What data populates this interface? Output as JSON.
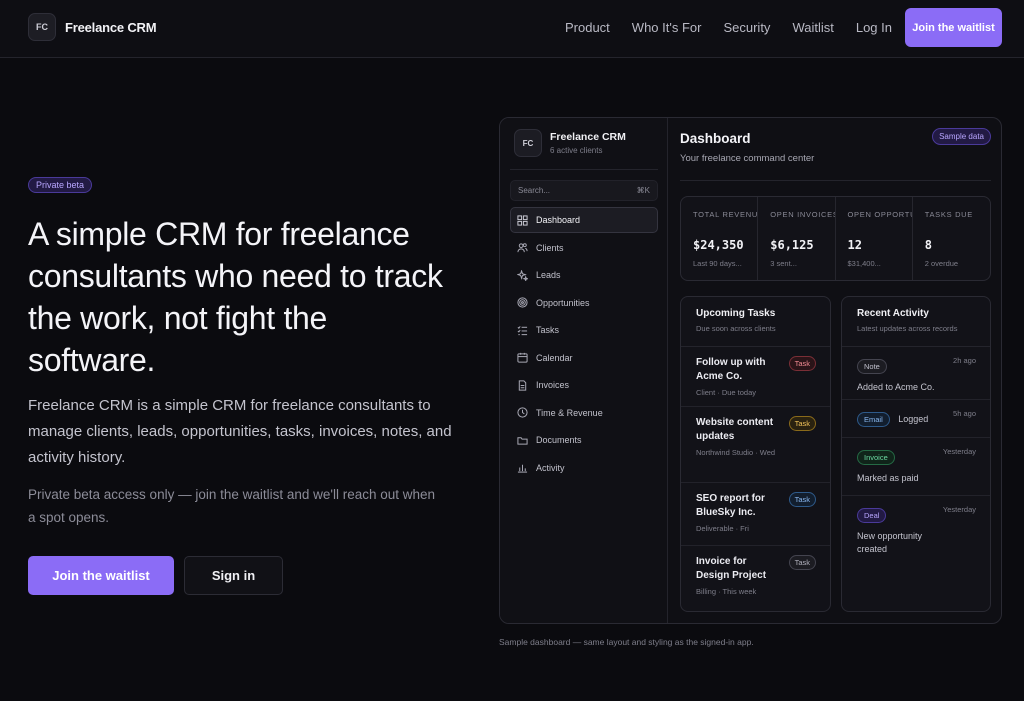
{
  "nav": {
    "logo_initials": "FC",
    "brand": "Freelance CRM",
    "links": [
      "Product",
      "Who It's For",
      "Security",
      "Waitlist",
      "Log In"
    ],
    "cta": "Join the waitlist"
  },
  "hero": {
    "badge": "Private beta",
    "title": "A simple CRM for freelance consultants who need to track the work, not fight the software.",
    "description": "Freelance CRM is a simple CRM for freelance consultants to manage clients, leads, opportunities, tasks, invoices, notes, and activity history.",
    "note": "Private beta access only — join the waitlist and we'll reach out when a spot opens.",
    "primary_button": "Join the waitlist",
    "secondary_button": "Sign in"
  },
  "preview": {
    "sidebar": {
      "logo_initials": "FC",
      "title": "Freelance CRM",
      "subtitle": "6 active clients",
      "search_placeholder": "Search...",
      "search_shortcut": "⌘K",
      "items": [
        {
          "label": "Dashboard",
          "icon": "dashboard-icon",
          "active": true
        },
        {
          "label": "Clients",
          "icon": "users-icon"
        },
        {
          "label": "Leads",
          "icon": "sparkle-icon"
        },
        {
          "label": "Opportunities",
          "icon": "target-icon"
        },
        {
          "label": "Tasks",
          "icon": "checklist-icon"
        },
        {
          "label": "Calendar",
          "icon": "calendar-icon"
        },
        {
          "label": "Invoices",
          "icon": "document-icon"
        },
        {
          "label": "Time & Revenue",
          "icon": "clock-icon"
        },
        {
          "label": "Documents",
          "icon": "folder-icon"
        },
        {
          "label": "Activity",
          "icon": "bar-chart-icon"
        }
      ]
    },
    "main": {
      "title": "Dashboard",
      "subtitle": "Your freelance command center",
      "sample_badge": "Sample data",
      "stats": [
        {
          "label": "TOTAL REVENUE",
          "value": "$24,350",
          "sub": "Last 90 days..."
        },
        {
          "label": "OPEN INVOICES",
          "value": "$6,125",
          "sub": "3 sent..."
        },
        {
          "label": "OPEN OPPORTUNITIES",
          "value": "12",
          "sub": "$31,400..."
        },
        {
          "label": "TASKS DUE",
          "value": "8",
          "sub": "2 overdue"
        }
      ],
      "tasks": {
        "title": "Upcoming Tasks",
        "subtitle": "Due soon across clients",
        "items": [
          {
            "title": "Follow up with Acme Co.",
            "meta": "Client · Due today",
            "tag": "Task",
            "color": "#f08a92"
          },
          {
            "title": "Website content updates",
            "meta": "Northwind Studio · Wed",
            "tag": "Task",
            "color": "#f0c25a"
          },
          {
            "title": "SEO report for BlueSky Inc.",
            "meta": "Deliverable · Fri",
            "tag": "Task",
            "color": "#8ab8f0"
          },
          {
            "title": "Invoice for Design Project",
            "meta": "Billing · This week",
            "tag": "Task",
            "color": "#b0b0bc"
          }
        ]
      },
      "activity": {
        "title": "Recent Activity",
        "subtitle": "Latest updates across records",
        "items": [
          {
            "tag": "Note",
            "time": "2h ago",
            "text": "Added to Acme Co."
          },
          {
            "tag": "Email",
            "time": "5h ago",
            "text": "Logged"
          },
          {
            "tag": "Invoice",
            "time": "Yesterday",
            "text": "Marked as paid"
          },
          {
            "tag": "Deal",
            "time": "Yesterday",
            "text": "New opportunity created"
          }
        ]
      }
    },
    "caption": "Sample dashboard — same layout and styling as the signed-in app."
  },
  "colors": {
    "accent": "#8b6cf6",
    "background": "#0b0b0f"
  }
}
